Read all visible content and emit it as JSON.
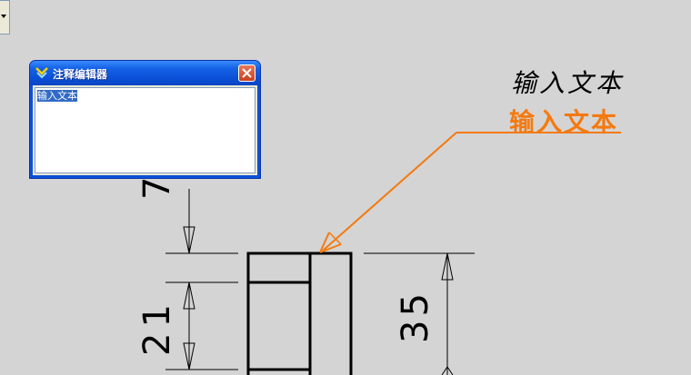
{
  "dialog": {
    "title": "注释编辑器",
    "text_value": "输入文本"
  },
  "annotations": {
    "black_text": "输入文本",
    "orange_text": "输入文本"
  },
  "dimensions": {
    "top": "7",
    "middle": "21",
    "right": "35"
  },
  "colors": {
    "canvas_background": "#d4d4d4",
    "leader_orange": "#f47a10",
    "dialog_title_blue": "#0a50d8"
  },
  "icons": {
    "dialog": "app-icon",
    "close": "close-icon",
    "dropdown": "chevron-down-icon"
  }
}
